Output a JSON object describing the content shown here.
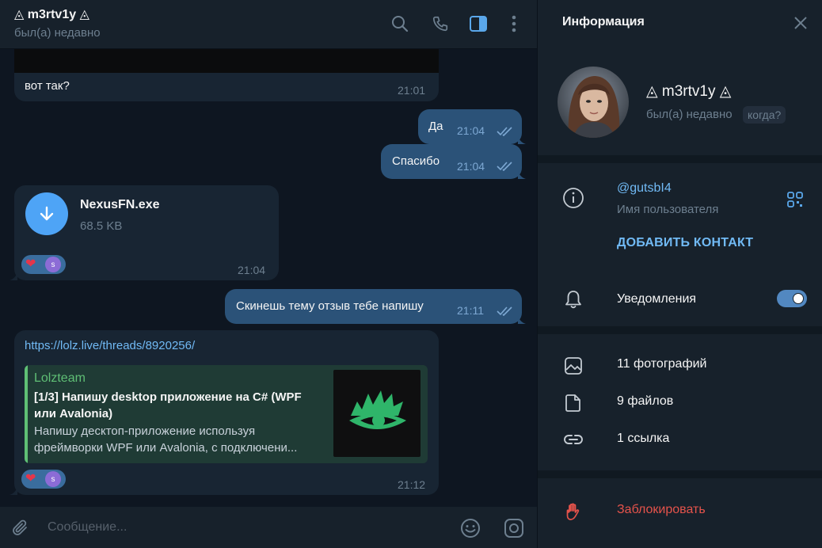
{
  "header": {
    "title": "◬ m3rtv1y ◬",
    "status": "был(а) недавно"
  },
  "messages": [
    {
      "type": "text",
      "direction": "in",
      "text": "вот так?",
      "time": "21:01"
    },
    {
      "type": "text",
      "direction": "out",
      "text": "Да",
      "time": "21:04",
      "read": true
    },
    {
      "type": "text",
      "direction": "out",
      "text": "Спасибо",
      "time": "21:04",
      "read": true
    },
    {
      "type": "file",
      "direction": "in",
      "file_name": "NexusFN.exe",
      "file_size": "68.5 KB",
      "time": "21:04",
      "reaction": {
        "emoji": "❤",
        "avatar_letter": "s"
      }
    },
    {
      "type": "text",
      "direction": "out",
      "text": "Скинешь тему отзыв тебе напишу",
      "time": "21:11",
      "read": true
    },
    {
      "type": "link",
      "direction": "in",
      "url": "https://lolz.live/threads/8920256/",
      "preview": {
        "site": "Lolzteam",
        "title_lines": [
          "[1/3] Напишу desktop приложение на C# (WPF",
          "или Avalonia)"
        ],
        "desc_lines": [
          "Напишу десктоп-приложение используя",
          "фреймворки WPF или Avalonia, с подключени..."
        ]
      },
      "time": "21:12",
      "reaction": {
        "emoji": "❤",
        "avatar_letter": "s"
      }
    }
  ],
  "composer": {
    "placeholder": "Сообщение..."
  },
  "info": {
    "title": "Информация",
    "name": "◬ m3rtv1y ◬",
    "status": "был(а) недавно",
    "when_chip": "когда?",
    "username": "@gutsbI4",
    "username_label": "Имя пользователя",
    "add_contact": "ДОБАВИТЬ КОНТАКТ",
    "notifications_label": "Уведомления",
    "notifications_on": true,
    "media": [
      {
        "icon": "photo-icon",
        "label": "11 фотографий"
      },
      {
        "icon": "file-icon",
        "label": "9 файлов"
      },
      {
        "icon": "link-icon",
        "label": "1 ссылка"
      }
    ],
    "block": "Заблокировать"
  },
  "colors": {
    "accent": "#71baf5",
    "bubble_out": "#2b5278",
    "bubble_in": "#182533",
    "danger": "#e5534b"
  }
}
